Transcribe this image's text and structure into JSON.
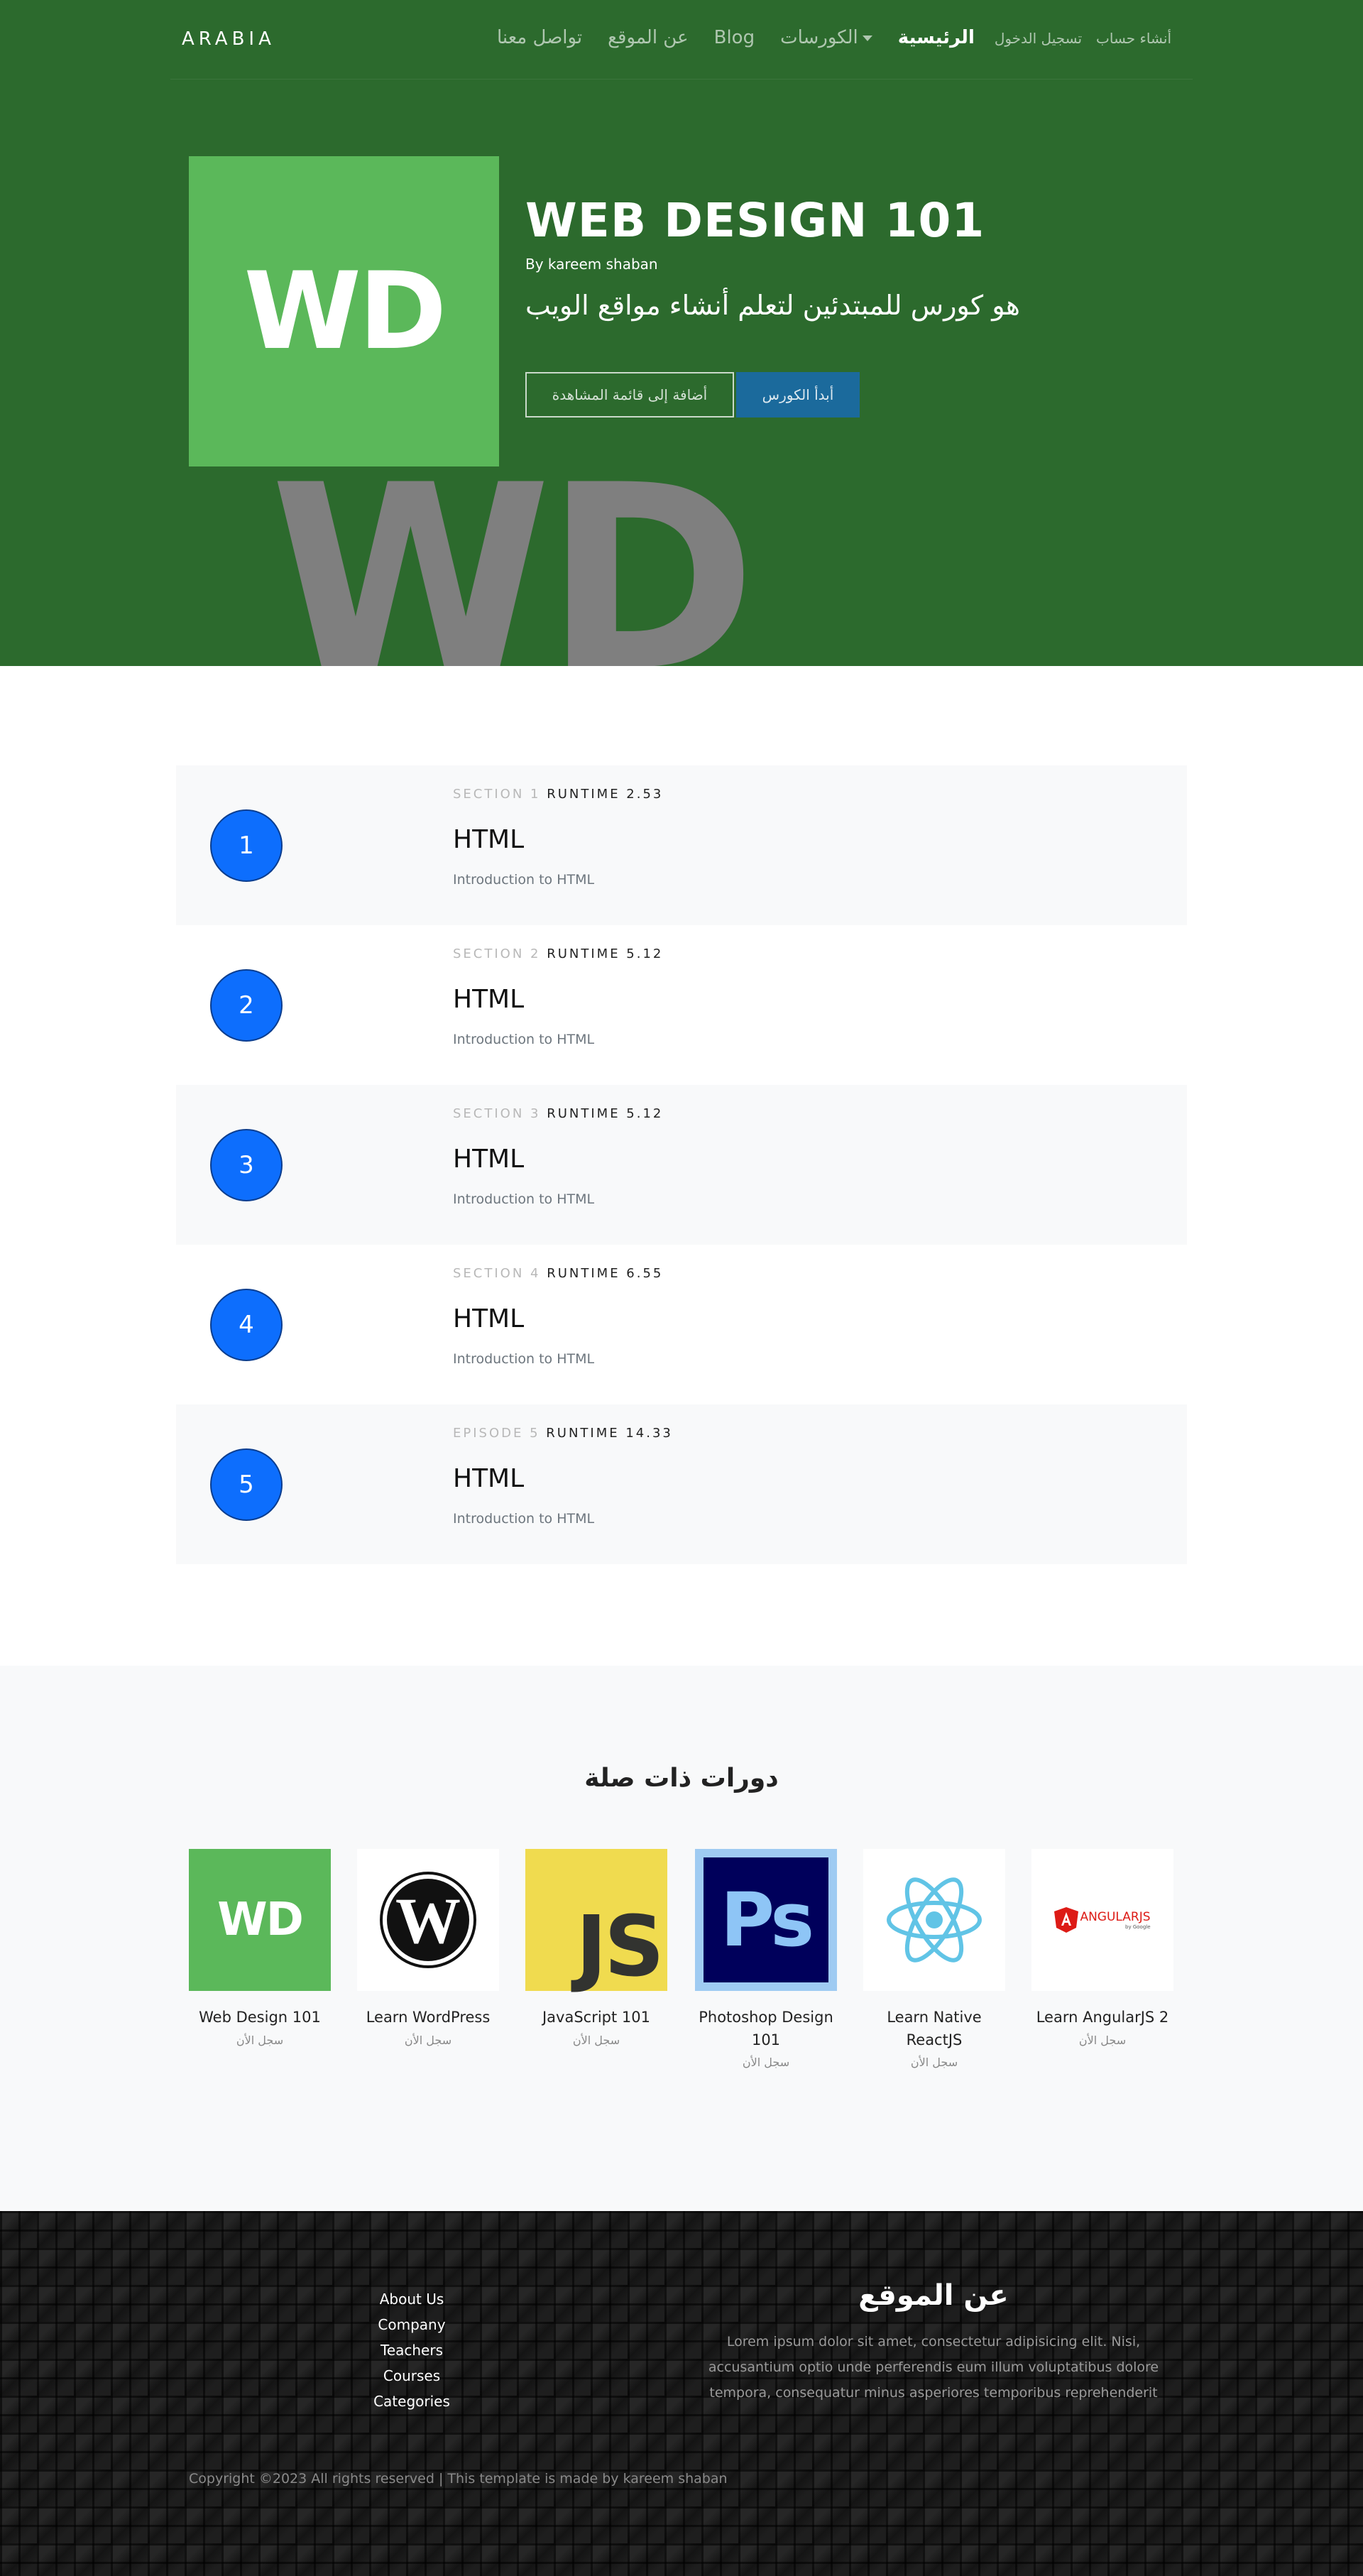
{
  "nav": {
    "brand": "ARABIA",
    "links": [
      "تواصل معنا",
      "عن الموقع",
      "Blog",
      "الكورسات",
      "الرئيسية"
    ],
    "register": "أنشاء حساب",
    "login": "تسجيل الدخول"
  },
  "hero": {
    "logo_text": "WD",
    "title": "WEB DESIGN 101",
    "author": "By kareem shaban",
    "description": "هو كورس للمبتدئين لتعلم أنشاء مواقع الويب",
    "watch_button": "أضافة إلى قائمة المشاهدة",
    "start_button": "أبدأ الكورس",
    "watermark": "WD"
  },
  "sections": [
    {
      "number": "1",
      "label": "SECTION 1",
      "runtime": "RUNTIME 2.53",
      "title": "HTML",
      "description": "Introduction to HTML"
    },
    {
      "number": "2",
      "label": "SECTION 2",
      "runtime": "RUNTIME 5.12",
      "title": "HTML",
      "description": "Introduction to HTML"
    },
    {
      "number": "3",
      "label": "SECTION 3",
      "runtime": "RUNTIME 5.12",
      "title": "HTML",
      "description": "Introduction to HTML"
    },
    {
      "number": "4",
      "label": "SECTION 4",
      "runtime": "RUNTIME 6.55",
      "title": "HTML",
      "description": "Introduction to HTML"
    },
    {
      "number": "5",
      "label": "EPISODE 5",
      "runtime": "RUNTIME 14.33",
      "title": "HTML",
      "description": "Introduction to HTML"
    }
  ],
  "related": {
    "title": "دورات ذات صلة",
    "cta": "سجل الأن",
    "courses": [
      {
        "name": "Web Design 101",
        "logo": "WD",
        "icon": "wd-logo-icon"
      },
      {
        "name": "Learn WordPress",
        "icon": "wordpress-logo-icon"
      },
      {
        "name": "JavaScript 101",
        "logo": "JS",
        "icon": "javascript-logo-icon"
      },
      {
        "name": "Photoshop Design 101",
        "logo": "Ps",
        "icon": "photoshop-logo-icon"
      },
      {
        "name": "Learn Native ReactJS",
        "icon": "react-logo-icon"
      },
      {
        "name": "Learn AngularJS 2",
        "logo": "ANGULARJS",
        "logo_sub": "by Google",
        "icon": "angular-logo-icon"
      }
    ]
  },
  "footer": {
    "links": [
      "About Us",
      "Company",
      "Teachers",
      "Courses",
      "Categories"
    ],
    "about_title": "عن الموقع",
    "about_text": "Lorem ipsum dolor sit amet, consectetur adipisicing elit. Nisi, accusantium optio unde perferendis eum illum voluptatibus dolore tempora, consequatur minus asperiores temporibus reprehenderit",
    "copyright": "Copyright ©2023 All rights reserved | This template is made by kareem shaban"
  },
  "colors": {
    "hero_bg": "#2c6a2d",
    "wd_green": "#5bb85a",
    "circle_blue": "#0d6efd",
    "start_button": "#1b6a9c"
  }
}
